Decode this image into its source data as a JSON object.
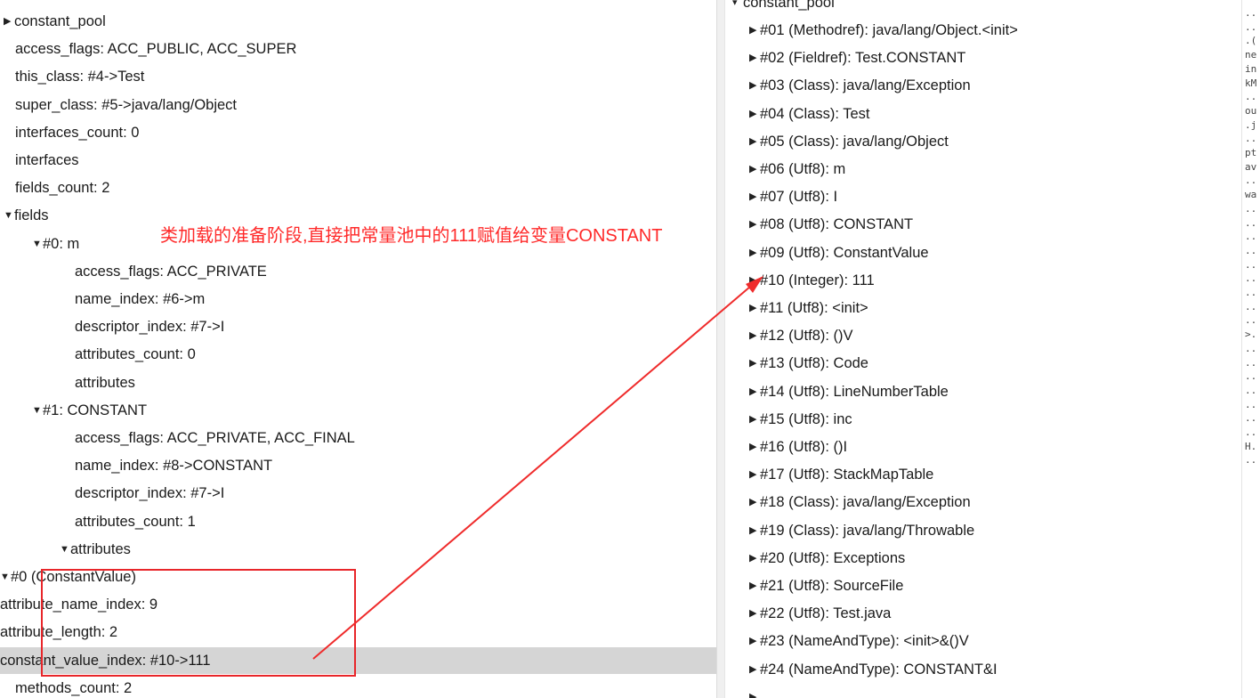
{
  "left_tree": [
    {
      "text": "constant_pool",
      "expander": "collapsed"
    },
    {
      "text": "access_flags: ACC_PUBLIC, ACC_SUPER",
      "expander": "none"
    },
    {
      "text": "this_class: #4->Test",
      "expander": "none"
    },
    {
      "text": "super_class: #5->java/lang/Object",
      "expander": "none"
    },
    {
      "text": "interfaces_count: 0",
      "expander": "none"
    },
    {
      "text": "interfaces",
      "expander": "none"
    },
    {
      "text": "fields_count: 2",
      "expander": "none"
    },
    {
      "text": "fields",
      "expander": "expanded"
    },
    {
      "text": "#0: m",
      "expander": "expanded"
    },
    {
      "text": "access_flags: ACC_PRIVATE",
      "expander": "none"
    },
    {
      "text": "name_index: #6->m",
      "expander": "none"
    },
    {
      "text": "descriptor_index: #7->I",
      "expander": "none"
    },
    {
      "text": "attributes_count: 0",
      "expander": "none"
    },
    {
      "text": "attributes",
      "expander": "none"
    },
    {
      "text": "#1: CONSTANT",
      "expander": "expanded"
    },
    {
      "text": "access_flags: ACC_PRIVATE, ACC_FINAL",
      "expander": "none"
    },
    {
      "text": "name_index: #8->CONSTANT",
      "expander": "none"
    },
    {
      "text": "descriptor_index: #7->I",
      "expander": "none"
    },
    {
      "text": "attributes_count: 1",
      "expander": "none"
    },
    {
      "text": "attributes",
      "expander": "expanded"
    },
    {
      "text": "#0 (ConstantValue)",
      "expander": "expanded"
    },
    {
      "text": "attribute_name_index: 9",
      "expander": "none"
    },
    {
      "text": "attribute_length: 2",
      "expander": "none"
    },
    {
      "text": "constant_value_index: #10->111",
      "expander": "none",
      "selected": true
    },
    {
      "text": "methods_count: 2",
      "expander": "none"
    }
  ],
  "right_tree": {
    "header": "constant_pool",
    "entries": [
      "#01 (Methodref): java/lang/Object.<init>",
      "#02 (Fieldref): Test.CONSTANT",
      "#03 (Class): java/lang/Exception",
      "#04 (Class): Test",
      "#05 (Class): java/lang/Object",
      "#06 (Utf8): m",
      "#07 (Utf8): I",
      "#08 (Utf8): CONSTANT",
      "#09 (Utf8): ConstantValue",
      "#10 (Integer): 111",
      "#11 (Utf8): <init>",
      "#12 (Utf8): ()V",
      "#13 (Utf8): Code",
      "#14 (Utf8): LineNumberTable",
      "#15 (Utf8): inc",
      "#16 (Utf8): ()I",
      "#17 (Utf8): StackMapTable",
      "#18 (Class): java/lang/Exception",
      "#19 (Class): java/lang/Throwable",
      "#20 (Utf8): Exceptions",
      "#21 (Utf8): SourceFile",
      "#22 (Utf8): Test.java",
      "#23 (NameAndType): <init>&()V",
      "#24 (NameAndType): CONSTANT&I"
    ]
  },
  "hex_column": [
    "..",
    "..",
    ".(",
    "ne",
    "in",
    "kM",
    "..",
    "ou",
    ".j",
    "..",
    "pt",
    "av",
    "..",
    "wa",
    "..",
    "..",
    "..",
    "..",
    "..",
    "..",
    "..",
    "..",
    "..",
    ">.",
    "..",
    "..",
    "..",
    "..",
    "..",
    "..",
    "..",
    "H.",
    ".."
  ],
  "annotation": {
    "text": "类加载的准备阶段,直接把常量池中的111赋值给变量CONSTANT",
    "color": "#ff2a2a"
  },
  "colors": {
    "selection": "#d5d5d5",
    "annotation_box": "#e8262a"
  }
}
